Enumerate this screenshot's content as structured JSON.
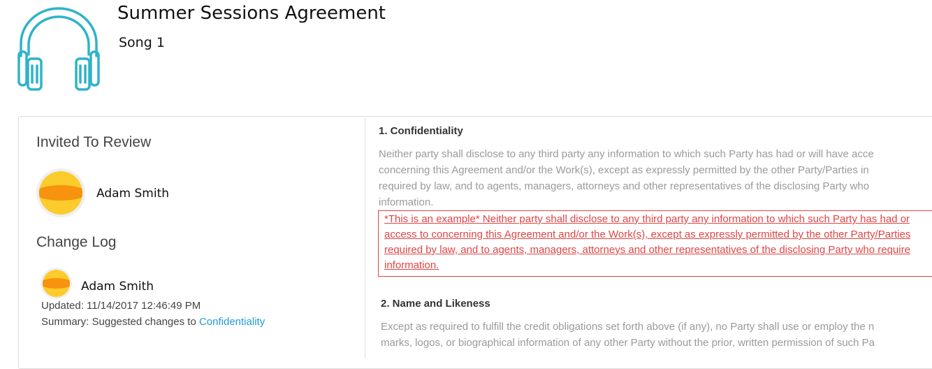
{
  "header": {
    "title": "Summer Sessions Agreement",
    "subtitle": "Song 1",
    "logo_icon": "headphones-icon",
    "logo_color": "#2fb3c9"
  },
  "sidebar": {
    "invited_heading": "Invited To Review",
    "reviewer": {
      "name": "Adam Smith",
      "avatar_icon": "avatar"
    },
    "changelog_heading": "Change Log",
    "log_entry": {
      "name": "Adam Smith",
      "updated": "Updated: 11/14/2017 12:46:49 PM",
      "summary_prefix": "Summary: Suggested changes to ",
      "summary_link": "Confidentiality"
    }
  },
  "document": {
    "clauses": [
      {
        "title": "1. Confidentiality",
        "lines": [
          "Neither party shall disclose to any third party any information to which such Party has had or will have acce",
          "concerning this Agreement and/or the Work(s), except as expressly permitted by the other Party/Parties in",
          "required by law, and to agents, managers, attorneys and other representatives of the disclosing Party who",
          "information."
        ],
        "suggestion_lines": [
          "*This is an example* Neither party shall disclose to any third party any information to which such Party has had or",
          "access to concerning this Agreement and/or the Work(s), except as expressly permitted by the other Party/Parties",
          "required by law, and to agents, managers, attorneys and other representatives of the disclosing Party who require",
          "information."
        ]
      },
      {
        "title": "2. Name and Likeness",
        "lines": [
          "Except as required to fulfill the credit obligations set forth above (if any), no Party shall use or employ the n",
          "marks, logos, or biographical information of any other Party without the prior, written permission of such Pa"
        ]
      }
    ]
  },
  "colors": {
    "accent": "#1e9bd7",
    "suggestion": "#e04545",
    "avatar_yellow": "#fccb2c",
    "avatar_orange": "#f7930e"
  }
}
